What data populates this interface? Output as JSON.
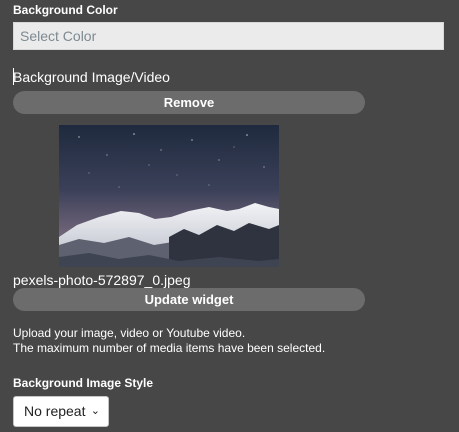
{
  "background_color": {
    "label": "Background Color",
    "placeholder": "Select Color"
  },
  "background_media": {
    "label": "Background Image/Video",
    "remove_label": "Remove",
    "filename": "pexels-photo-572897_0.jpeg",
    "update_label": "Update widget",
    "help_line_1": "Upload your image, video or Youtube video.",
    "help_line_2": "The maximum number of media items have been selected."
  },
  "background_style": {
    "label": "Background Image Style",
    "selected": "No repeat"
  },
  "colors": {
    "panel_bg": "#474747",
    "button_bg": "#6c6c6c",
    "input_bg": "#ebebeb"
  }
}
